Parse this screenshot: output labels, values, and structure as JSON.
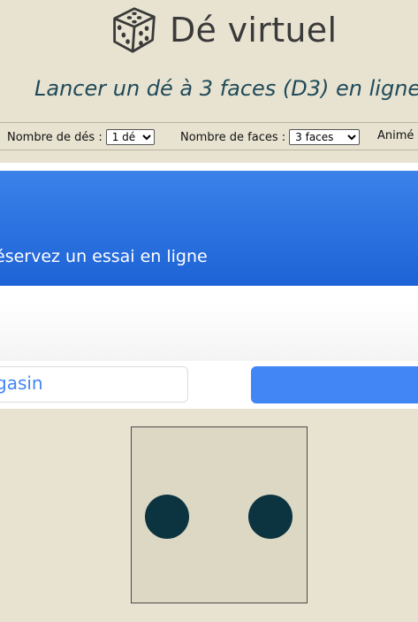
{
  "header": {
    "logo_icon": "dice-icon",
    "title": "Dé virtuel",
    "subtitle": "Lancer un dé à 3 faces (D3) en ligne"
  },
  "controls": {
    "dice_count_label": "Nombre de dés :",
    "dice_count_value": "1 dé",
    "faces_label": "Nombre de faces :",
    "faces_value": "3 faces",
    "animation_label": "Animé"
  },
  "ad": {
    "banner_text": "éservez un essai en ligne",
    "input_text": "gasin"
  },
  "die": {
    "value": 2
  },
  "colors": {
    "background": "#e8e3d1",
    "title_text": "#3a3a3a",
    "subtitle_text": "#1f4a5a",
    "ad_blue": "#3b82ea",
    "ad_button_blue": "#4285f4",
    "die_face": "#dcd8c4",
    "pip": "#0c3440"
  }
}
